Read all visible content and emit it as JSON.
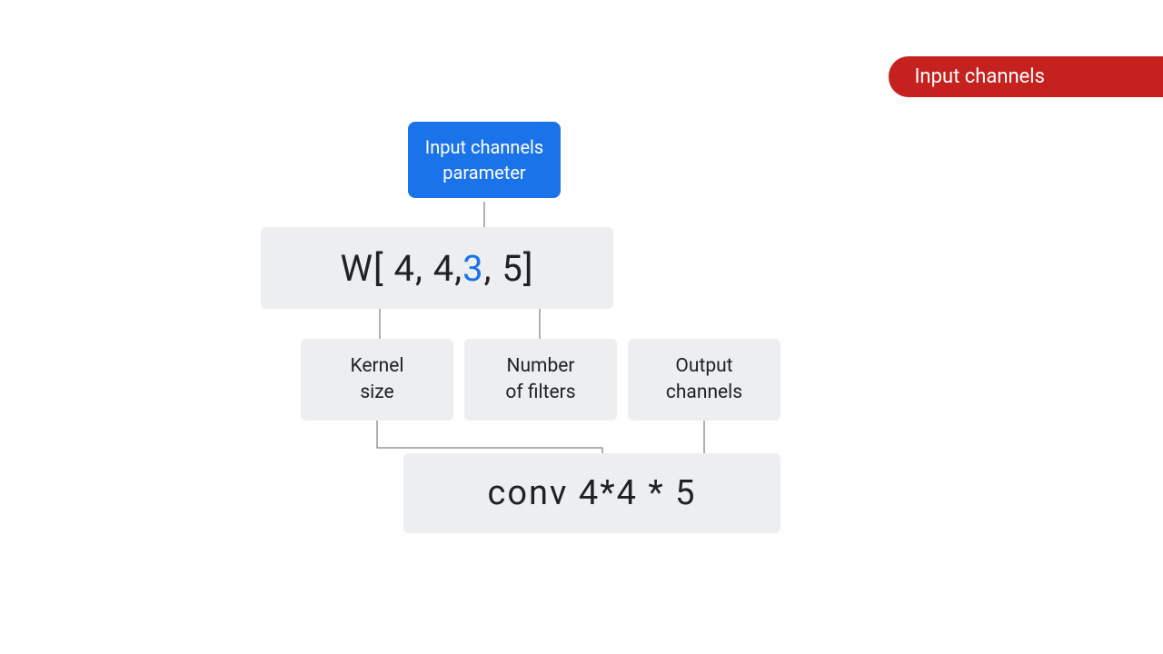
{
  "title_badge": "Input channels",
  "blue_badge": {
    "line1": "Input channels",
    "line2": "parameter"
  },
  "code": {
    "prefix": "W[ 4,  4,  ",
    "highlight": "3",
    "suffix": ",  5]"
  },
  "labels": {
    "kernel": {
      "line1": "Kernel",
      "line2": "size"
    },
    "filters": {
      "line1": "Number",
      "line2": "of filters"
    },
    "output": {
      "line1": "Output",
      "line2": "channels"
    }
  },
  "conv": "conv  4*4  *  5"
}
